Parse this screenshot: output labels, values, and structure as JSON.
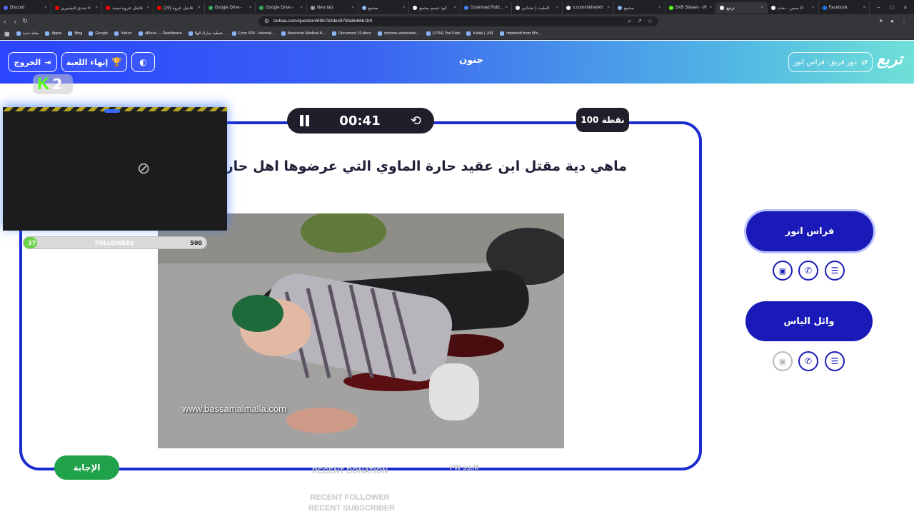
{
  "browser": {
    "tabs": [
      {
        "title": "Discord",
        "color": "#5865f2",
        "active": false
      },
      {
        "title": "تحدي البيتبيريز #",
        "color": "#ff0000",
        "active": false
      },
      {
        "title": "فاشل عروة نسبة",
        "color": "#ff0000",
        "active": false
      },
      {
        "title": "(29) فاشل عروة",
        "color": "#ff0000",
        "active": false
      },
      {
        "title": "Google Drive -",
        "color": "#34a853",
        "active": false
      },
      {
        "title": "Google Drive -",
        "color": "#34a853",
        "active": false
      },
      {
        "title": "New tab",
        "color": "#9aa0a6",
        "active": false
      },
      {
        "title": "مجمع",
        "color": "#8ab4f8",
        "active": false
      },
      {
        "title": "كود حسم مجمع",
        "color": "#ffffff",
        "active": false
      },
      {
        "title": "Download Robl...",
        "color": "#4285f4",
        "active": false
      },
      {
        "title": "المليت | تحداني",
        "color": "#ffffff",
        "active": false
      },
      {
        "title": "x.com/mkhenkh",
        "color": "#ffffff",
        "active": false
      },
      {
        "title": "مجمع",
        "color": "#8ab4f8",
        "active": false
      },
      {
        "title": "SXB Stream - W",
        "color": "#53fc18",
        "active": false
      },
      {
        "title": "ترتيع",
        "color": "#ffffff",
        "active": true
      },
      {
        "title": "مسن - بحث G",
        "color": "#ffffff",
        "active": false
      },
      {
        "title": "Facebook",
        "color": "#1877f2",
        "active": false
      }
    ],
    "url": "tarbaa.com/question/69b7b3dec876fa8e6661b0",
    "bookmarks": [
      "مقلد جديد",
      "Apple",
      "Bing",
      "Google",
      "Yahoo",
      "uBlock — Dashboard",
      "تغطية مباراة الهلا...",
      "Error 500 - Internal...",
      "American Medical A...",
      "Document 10.docx",
      "chrome-extension/...",
      "(1764) YouTube",
      "Kalak | كلاك",
      "Imported from Mic..."
    ]
  },
  "header": {
    "exit_label": "الخروج",
    "end_game_label": "إنهاء اللعبة",
    "category_title": "جنون",
    "turn_label": "دور فريق: فراس انور",
    "logo_text": "تربع",
    "bg_start": "#2a44ff",
    "bg_end": "#6fe0d7"
  },
  "question": {
    "timer": "00:41",
    "points": "100 نقطة",
    "text": "ماهي دية مقتل ابن عقيد حارة الماوي التي عرضوها اهل حارة الضبع؟",
    "image_watermark": "www.bassamalmalla.com",
    "answer_label": "الإجابة"
  },
  "teams": [
    {
      "name": "فراس انور",
      "selected": true,
      "lifelines_used": [
        false,
        false,
        false
      ]
    },
    {
      "name": "وائل الياس",
      "selected": false,
      "lifelines_used": [
        true,
        false,
        false
      ]
    }
  ],
  "overlay": {
    "kick_count": "2",
    "followers_current": "37",
    "followers_label": "FOLLOWERS",
    "followers_goal": "500",
    "followers_progress": 0.074,
    "recent_donation": "RECENT DONATION",
    "recent_follower": "RECENT FOLLOWER",
    "recent_subscriber": "RECENT SUBSCRIBER",
    "ghost_name": "FW ss.M"
  },
  "colors": {
    "card_border": "#1a2bd0",
    "team_button": "#1a1ab8",
    "answer_button": "#1fa24a",
    "dark_pill": "#1e1f2a"
  }
}
